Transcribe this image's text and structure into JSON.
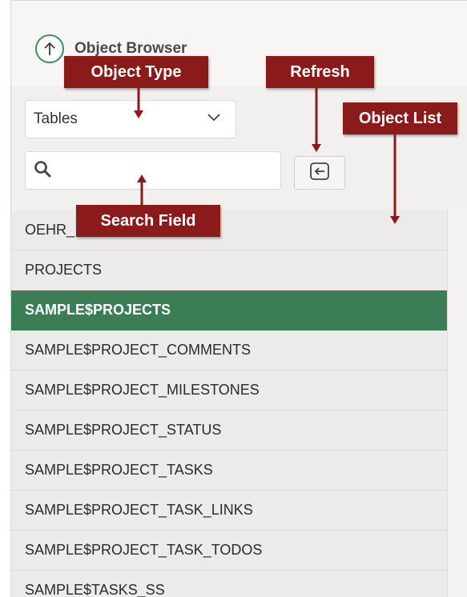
{
  "header": {
    "title": "Object Browser",
    "icon": "arrow-up-circle-icon"
  },
  "object_type": {
    "selected": "Tables"
  },
  "search": {
    "placeholder": "",
    "value": ""
  },
  "refresh": {
    "icon": "refresh-icon"
  },
  "list": {
    "items": [
      {
        "label": "OEHR_",
        "selected": false
      },
      {
        "label": "PROJECTS",
        "selected": false
      },
      {
        "label": "SAMPLE$PROJECTS",
        "selected": true
      },
      {
        "label": "SAMPLE$PROJECT_COMMENTS",
        "selected": false
      },
      {
        "label": "SAMPLE$PROJECT_MILESTONES",
        "selected": false
      },
      {
        "label": "SAMPLE$PROJECT_STATUS",
        "selected": false
      },
      {
        "label": "SAMPLE$PROJECT_TASKS",
        "selected": false
      },
      {
        "label": "SAMPLE$PROJECT_TASK_LINKS",
        "selected": false
      },
      {
        "label": "SAMPLE$PROJECT_TASK_TODOS",
        "selected": false
      },
      {
        "label": "SAMPLE$TASKS_SS",
        "selected": false
      }
    ]
  },
  "callouts": {
    "object_type": "Object Type",
    "refresh": "Refresh",
    "object_list": "Object List",
    "search_field": "Search Field"
  },
  "colors": {
    "accent": "#3b7d55",
    "callout": "#8b1a1a"
  }
}
